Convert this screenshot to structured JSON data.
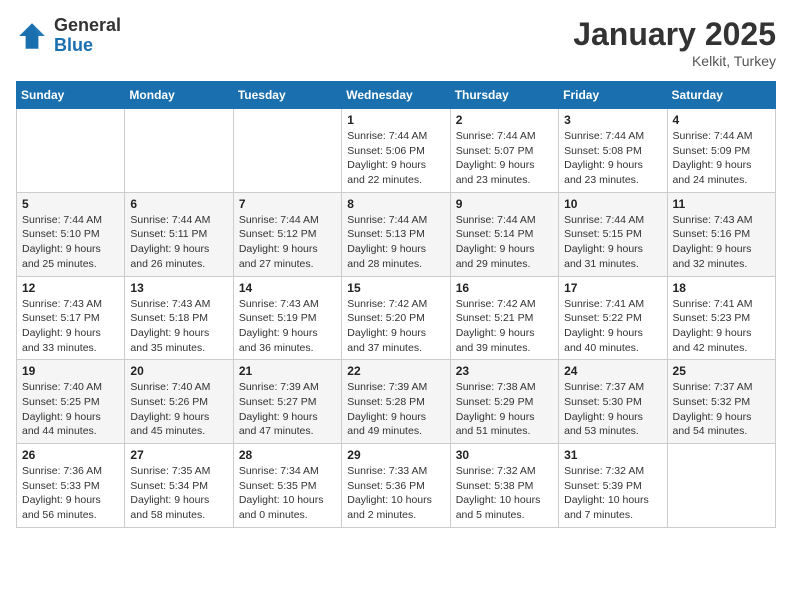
{
  "header": {
    "logo_general": "General",
    "logo_blue": "Blue",
    "month_year": "January 2025",
    "location": "Kelkit, Turkey"
  },
  "weekdays": [
    "Sunday",
    "Monday",
    "Tuesday",
    "Wednesday",
    "Thursday",
    "Friday",
    "Saturday"
  ],
  "weeks": [
    [
      {
        "day": "",
        "info": ""
      },
      {
        "day": "",
        "info": ""
      },
      {
        "day": "",
        "info": ""
      },
      {
        "day": "1",
        "info": "Sunrise: 7:44 AM\nSunset: 5:06 PM\nDaylight: 9 hours and 22 minutes."
      },
      {
        "day": "2",
        "info": "Sunrise: 7:44 AM\nSunset: 5:07 PM\nDaylight: 9 hours and 23 minutes."
      },
      {
        "day": "3",
        "info": "Sunrise: 7:44 AM\nSunset: 5:08 PM\nDaylight: 9 hours and 23 minutes."
      },
      {
        "day": "4",
        "info": "Sunrise: 7:44 AM\nSunset: 5:09 PM\nDaylight: 9 hours and 24 minutes."
      }
    ],
    [
      {
        "day": "5",
        "info": "Sunrise: 7:44 AM\nSunset: 5:10 PM\nDaylight: 9 hours and 25 minutes."
      },
      {
        "day": "6",
        "info": "Sunrise: 7:44 AM\nSunset: 5:11 PM\nDaylight: 9 hours and 26 minutes."
      },
      {
        "day": "7",
        "info": "Sunrise: 7:44 AM\nSunset: 5:12 PM\nDaylight: 9 hours and 27 minutes."
      },
      {
        "day": "8",
        "info": "Sunrise: 7:44 AM\nSunset: 5:13 PM\nDaylight: 9 hours and 28 minutes."
      },
      {
        "day": "9",
        "info": "Sunrise: 7:44 AM\nSunset: 5:14 PM\nDaylight: 9 hours and 29 minutes."
      },
      {
        "day": "10",
        "info": "Sunrise: 7:44 AM\nSunset: 5:15 PM\nDaylight: 9 hours and 31 minutes."
      },
      {
        "day": "11",
        "info": "Sunrise: 7:43 AM\nSunset: 5:16 PM\nDaylight: 9 hours and 32 minutes."
      }
    ],
    [
      {
        "day": "12",
        "info": "Sunrise: 7:43 AM\nSunset: 5:17 PM\nDaylight: 9 hours and 33 minutes."
      },
      {
        "day": "13",
        "info": "Sunrise: 7:43 AM\nSunset: 5:18 PM\nDaylight: 9 hours and 35 minutes."
      },
      {
        "day": "14",
        "info": "Sunrise: 7:43 AM\nSunset: 5:19 PM\nDaylight: 9 hours and 36 minutes."
      },
      {
        "day": "15",
        "info": "Sunrise: 7:42 AM\nSunset: 5:20 PM\nDaylight: 9 hours and 37 minutes."
      },
      {
        "day": "16",
        "info": "Sunrise: 7:42 AM\nSunset: 5:21 PM\nDaylight: 9 hours and 39 minutes."
      },
      {
        "day": "17",
        "info": "Sunrise: 7:41 AM\nSunset: 5:22 PM\nDaylight: 9 hours and 40 minutes."
      },
      {
        "day": "18",
        "info": "Sunrise: 7:41 AM\nSunset: 5:23 PM\nDaylight: 9 hours and 42 minutes."
      }
    ],
    [
      {
        "day": "19",
        "info": "Sunrise: 7:40 AM\nSunset: 5:25 PM\nDaylight: 9 hours and 44 minutes."
      },
      {
        "day": "20",
        "info": "Sunrise: 7:40 AM\nSunset: 5:26 PM\nDaylight: 9 hours and 45 minutes."
      },
      {
        "day": "21",
        "info": "Sunrise: 7:39 AM\nSunset: 5:27 PM\nDaylight: 9 hours and 47 minutes."
      },
      {
        "day": "22",
        "info": "Sunrise: 7:39 AM\nSunset: 5:28 PM\nDaylight: 9 hours and 49 minutes."
      },
      {
        "day": "23",
        "info": "Sunrise: 7:38 AM\nSunset: 5:29 PM\nDaylight: 9 hours and 51 minutes."
      },
      {
        "day": "24",
        "info": "Sunrise: 7:37 AM\nSunset: 5:30 PM\nDaylight: 9 hours and 53 minutes."
      },
      {
        "day": "25",
        "info": "Sunrise: 7:37 AM\nSunset: 5:32 PM\nDaylight: 9 hours and 54 minutes."
      }
    ],
    [
      {
        "day": "26",
        "info": "Sunrise: 7:36 AM\nSunset: 5:33 PM\nDaylight: 9 hours and 56 minutes."
      },
      {
        "day": "27",
        "info": "Sunrise: 7:35 AM\nSunset: 5:34 PM\nDaylight: 9 hours and 58 minutes."
      },
      {
        "day": "28",
        "info": "Sunrise: 7:34 AM\nSunset: 5:35 PM\nDaylight: 10 hours and 0 minutes."
      },
      {
        "day": "29",
        "info": "Sunrise: 7:33 AM\nSunset: 5:36 PM\nDaylight: 10 hours and 2 minutes."
      },
      {
        "day": "30",
        "info": "Sunrise: 7:32 AM\nSunset: 5:38 PM\nDaylight: 10 hours and 5 minutes."
      },
      {
        "day": "31",
        "info": "Sunrise: 7:32 AM\nSunset: 5:39 PM\nDaylight: 10 hours and 7 minutes."
      },
      {
        "day": "",
        "info": ""
      }
    ]
  ]
}
